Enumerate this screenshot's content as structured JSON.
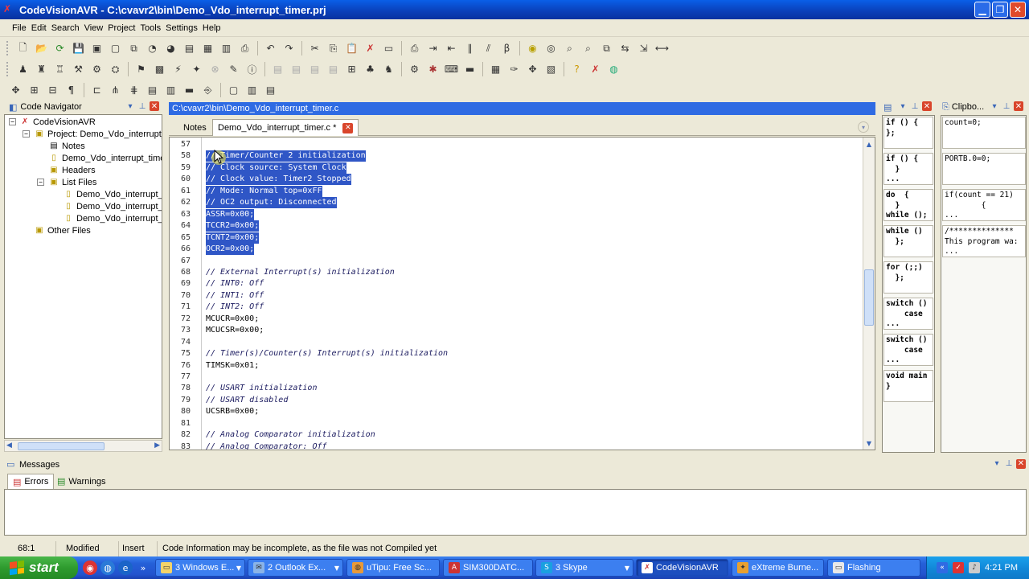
{
  "window": {
    "title": "CodeVisionAVR - C:\\cvavr2\\bin\\Demo_Vdo_interrupt_timer.prj"
  },
  "menu": [
    "File",
    "Edit",
    "Search",
    "View",
    "Project",
    "Tools",
    "Settings",
    "Help"
  ],
  "navigator": {
    "title": "Code Navigator",
    "tree": [
      {
        "label": "CodeVisionAVR",
        "icon": "codevision-icon"
      },
      {
        "label": "Project: Demo_Vdo_interrupt_ti",
        "icon": "project-icon"
      },
      {
        "label": "Notes",
        "icon": "notes-icon"
      },
      {
        "label": "Demo_Vdo_interrupt_timer.",
        "icon": "file-icon"
      },
      {
        "label": "Headers",
        "icon": "folder-icon"
      },
      {
        "label": "List Files",
        "icon": "folder-icon"
      },
      {
        "label": "Demo_Vdo_interrupt_ti",
        "icon": "file-icon"
      },
      {
        "label": "Demo_Vdo_interrupt_ti",
        "icon": "file-icon"
      },
      {
        "label": "Demo_Vdo_interrupt_ti",
        "icon": "file-icon"
      },
      {
        "label": "Other Files",
        "icon": "folder-icon"
      }
    ]
  },
  "editor": {
    "path": "C:\\cvavr2\\bin\\Demo_Vdo_interrupt_timer.c",
    "tabs": [
      {
        "label": "Notes"
      },
      {
        "label": "Demo_Vdo_interrupt_timer.c *"
      }
    ],
    "lines": [
      {
        "n": "57",
        "text": "",
        "kind": "code"
      },
      {
        "n": "58",
        "text": "// Timer/Counter 2 initialization",
        "kind": "sel"
      },
      {
        "n": "59",
        "text": "// Clock source: System Clock",
        "kind": "sel"
      },
      {
        "n": "60",
        "text": "// Clock value: Timer2 Stopped",
        "kind": "sel"
      },
      {
        "n": "61",
        "text": "// Mode: Normal top=0xFF",
        "kind": "sel"
      },
      {
        "n": "62",
        "text": "// OC2 output: Disconnected",
        "kind": "sel"
      },
      {
        "n": "63",
        "text": "ASSR=0x00;",
        "kind": "sel"
      },
      {
        "n": "64",
        "text": "TCCR2=0x00;",
        "kind": "sel"
      },
      {
        "n": "65",
        "text": "TCNT2=0x00;",
        "kind": "sel"
      },
      {
        "n": "66",
        "text": "OCR2=0x00;",
        "kind": "sel"
      },
      {
        "n": "67",
        "text": "",
        "kind": "code"
      },
      {
        "n": "68",
        "text": "// External Interrupt(s) initialization",
        "kind": "comment"
      },
      {
        "n": "69",
        "text": "// INT0: Off",
        "kind": "comment"
      },
      {
        "n": "70",
        "text": "// INT1: Off",
        "kind": "comment"
      },
      {
        "n": "71",
        "text": "// INT2: Off",
        "kind": "comment"
      },
      {
        "n": "72",
        "text": "MCUCR=0x00;",
        "kind": "code"
      },
      {
        "n": "73",
        "text": "MCUCSR=0x00;",
        "kind": "code"
      },
      {
        "n": "74",
        "text": "",
        "kind": "code"
      },
      {
        "n": "75",
        "text": "// Timer(s)/Counter(s) Interrupt(s) initialization",
        "kind": "comment"
      },
      {
        "n": "76",
        "text": "TIMSK=0x01;",
        "kind": "code"
      },
      {
        "n": "77",
        "text": "",
        "kind": "code"
      },
      {
        "n": "78",
        "text": "// USART initialization",
        "kind": "comment"
      },
      {
        "n": "79",
        "text": "// USART disabled",
        "kind": "comment"
      },
      {
        "n": "80",
        "text": "UCSRB=0x00;",
        "kind": "code"
      },
      {
        "n": "81",
        "text": "",
        "kind": "code"
      },
      {
        "n": "82",
        "text": "// Analog Comparator initialization",
        "kind": "comment"
      },
      {
        "n": "83",
        "text": "// Analog Comparator: Off",
        "kind": "comment"
      }
    ]
  },
  "templates": {
    "items": [
      "if () {\n};",
      "if () {\n  }\n...",
      "do  {\n  }\nwhile ();",
      "while ()\n  };",
      "for (;;)\n  };",
      "switch ()\n    case\n...",
      "switch ()\n    case\n...",
      "void main\n}"
    ]
  },
  "clipboard": {
    "title": "Clipbo...",
    "items": [
      "count=0;",
      "PORTB.0=0;",
      "if(count == 21)\n        {\n...",
      "/**************\nThis program wa:\n..."
    ]
  },
  "messages": {
    "title": "Messages",
    "tabs": [
      "Errors",
      "Warnings"
    ]
  },
  "status": {
    "position": "68:1",
    "modified": "Modified",
    "mode": "Insert",
    "info": "Code Information may be incomplete, as the file was not Compiled yet"
  },
  "taskbar": {
    "start": "start",
    "tasks": [
      "3 Windows E...",
      "2 Outlook Ex...",
      "uTipu: Free Sc...",
      "SIM300DATC...",
      "3 Skype",
      "CodeVisionAVR",
      "eXtreme Burne...",
      "Flashing"
    ],
    "clock": "4:21 PM"
  }
}
